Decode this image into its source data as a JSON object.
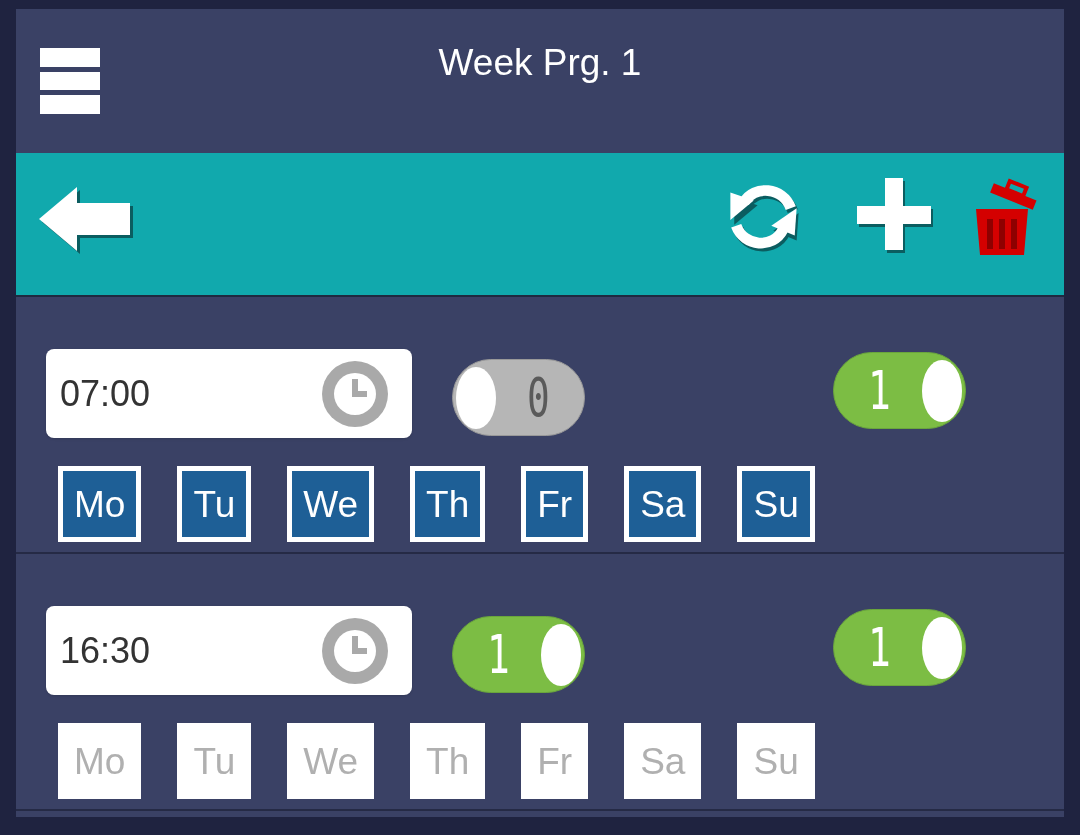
{
  "header": {
    "title": "Week Prg. 1"
  },
  "schedule": [
    {
      "time": "07:00",
      "switches": [
        {
          "label": "0",
          "on": false
        },
        {
          "label": "1",
          "on": true
        }
      ],
      "days": [
        {
          "label": "Mo",
          "selected": true
        },
        {
          "label": "Tu",
          "selected": true
        },
        {
          "label": "We",
          "selected": true
        },
        {
          "label": "Th",
          "selected": true
        },
        {
          "label": "Fr",
          "selected": true
        },
        {
          "label": "Sa",
          "selected": true
        },
        {
          "label": "Su",
          "selected": true
        }
      ]
    },
    {
      "time": "16:30",
      "switches": [
        {
          "label": "1",
          "on": true
        },
        {
          "label": "1",
          "on": true
        }
      ],
      "days": [
        {
          "label": "Mo",
          "selected": false
        },
        {
          "label": "Tu",
          "selected": false
        },
        {
          "label": "We",
          "selected": false
        },
        {
          "label": "Th",
          "selected": false
        },
        {
          "label": "Fr",
          "selected": false
        },
        {
          "label": "Sa",
          "selected": false
        },
        {
          "label": "Su",
          "selected": false
        }
      ]
    }
  ]
}
